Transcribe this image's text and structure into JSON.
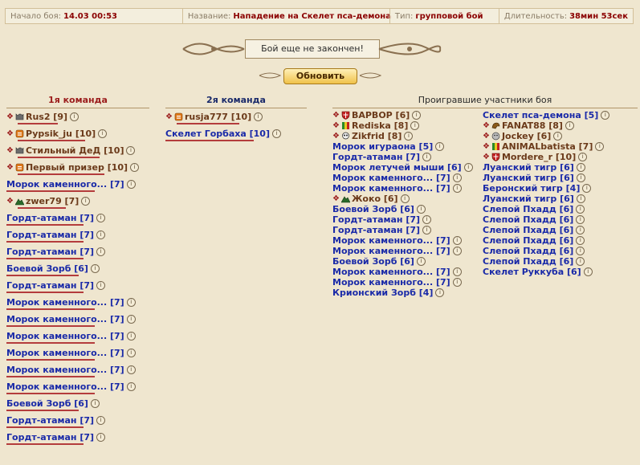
{
  "topbar": {
    "start_label": "Начало боя:",
    "start_value": "14.03 00:53",
    "name_label": "Название:",
    "name_value": "Нападение на Скелет пса-демона",
    "type_label": "Тип:",
    "type_value": "групповой бой",
    "duration_label": "Длительность:",
    "duration_value": "38мин 53сек"
  },
  "status_text": "Бой еще не закончен!",
  "refresh_label": "Обновить",
  "team1": {
    "title": "1я команда",
    "players": [
      {
        "name": "Rus2 [9]",
        "bot": false,
        "icon": "wolf-icon"
      },
      {
        "name": "Pypsik_ju [10]",
        "bot": false,
        "icon": "clan-icon"
      },
      {
        "name": "Стильный ДеД [10]",
        "bot": false,
        "icon": "wolf-icon"
      },
      {
        "name": "Первый призер [10]",
        "bot": false,
        "icon": "clan-icon"
      },
      {
        "name": "Морок каменного... [7]",
        "bot": true
      },
      {
        "name": "zwer79 [7]",
        "bot": false,
        "icon": "mountain-icon"
      },
      {
        "name": "Гордт-атаман [7]",
        "bot": true
      },
      {
        "name": "Гордт-атаман [7]",
        "bot": true
      },
      {
        "name": "Гордт-атаман [7]",
        "bot": true
      },
      {
        "name": "Боевой Зорб [6]",
        "bot": true
      },
      {
        "name": "Гордт-атаман [7]",
        "bot": true
      },
      {
        "name": "Морок каменного... [7]",
        "bot": true
      },
      {
        "name": "Морок каменного... [7]",
        "bot": true
      },
      {
        "name": "Морок каменного... [7]",
        "bot": true
      },
      {
        "name": "Морок каменного... [7]",
        "bot": true
      },
      {
        "name": "Морок каменного... [7]",
        "bot": true
      },
      {
        "name": "Морок каменного... [7]",
        "bot": true
      },
      {
        "name": "Боевой Зорб [6]",
        "bot": true
      },
      {
        "name": "Гордт-атаман [7]",
        "bot": true
      },
      {
        "name": "Гордт-атаман [7]",
        "bot": true
      }
    ]
  },
  "team2": {
    "title": "2я команда",
    "players": [
      {
        "name": "rusja777 [10]",
        "bot": false,
        "icon": "clan-icon"
      },
      {
        "name": "Скелет Горбаха [10]",
        "bot": true
      }
    ]
  },
  "losers": {
    "title": "Проигравшие участники боя",
    "col_a": [
      {
        "name": "ВАРВОР [6]",
        "bot": false,
        "icon": "shield-icon"
      },
      {
        "name": "Rediska [8]",
        "bot": false,
        "icon": "flag-icon"
      },
      {
        "name": "Zikfrid [8]",
        "bot": false,
        "icon": "skull-icon"
      },
      {
        "name": "Морок игураона [5]",
        "bot": true
      },
      {
        "name": "Гордт-атаман [7]",
        "bot": true
      },
      {
        "name": "Морок летучей мыши [6]",
        "bot": true
      },
      {
        "name": "Морок каменного... [7]",
        "bot": true
      },
      {
        "name": "Морок каменного... [7]",
        "bot": true
      },
      {
        "name": "Жоко [6]",
        "bot": false,
        "icon": "mountain-icon"
      },
      {
        "name": "Боевой Зорб [6]",
        "bot": true
      },
      {
        "name": "Гордт-атаман [7]",
        "bot": true
      },
      {
        "name": "Гордт-атаман [7]",
        "bot": true
      },
      {
        "name": "Морок каменного... [7]",
        "bot": true
      },
      {
        "name": "Морок каменного... [7]",
        "bot": true
      },
      {
        "name": "Боевой Зорб [6]",
        "bot": true
      },
      {
        "name": "Морок каменного... [7]",
        "bot": true
      },
      {
        "name": "Морок каменного... [7]",
        "bot": true
      },
      {
        "name": "Крионский Зорб [4]",
        "bot": true
      }
    ],
    "col_b": [
      {
        "name": "Скелет пса-демона [5]",
        "bot": true
      },
      {
        "name": "FANAT88 [8]",
        "bot": false,
        "icon": "dragon-icon"
      },
      {
        "name": "Jockey [6]",
        "bot": false,
        "icon": "face-icon"
      },
      {
        "name": "ANIMALbatista [7]",
        "bot": false,
        "icon": "flag-icon"
      },
      {
        "name": "Mordere_r [10]",
        "bot": false,
        "icon": "shield-icon"
      },
      {
        "name": "Луанский тигр [6]",
        "bot": true
      },
      {
        "name": "Луанский тигр [6]",
        "bot": true
      },
      {
        "name": "Беронский тигр [4]",
        "bot": true
      },
      {
        "name": "Луанский тигр [6]",
        "bot": true
      },
      {
        "name": "Слепой Пхадд [6]",
        "bot": true
      },
      {
        "name": "Слепой Пхадд [6]",
        "bot": true
      },
      {
        "name": "Слепой Пхадд [6]",
        "bot": true
      },
      {
        "name": "Слепой Пхадд [6]",
        "bot": true
      },
      {
        "name": "Слепой Пхадд [6]",
        "bot": true
      },
      {
        "name": "Слепой Пхадд [6]",
        "bot": true
      },
      {
        "name": "Скелет Руккуба [6]",
        "bot": true
      }
    ]
  },
  "colors": {
    "accent": "#8b0000",
    "bot_name": "#1a2aa8",
    "player_name": "#6b3a1a",
    "hp": "#b43c3c"
  }
}
